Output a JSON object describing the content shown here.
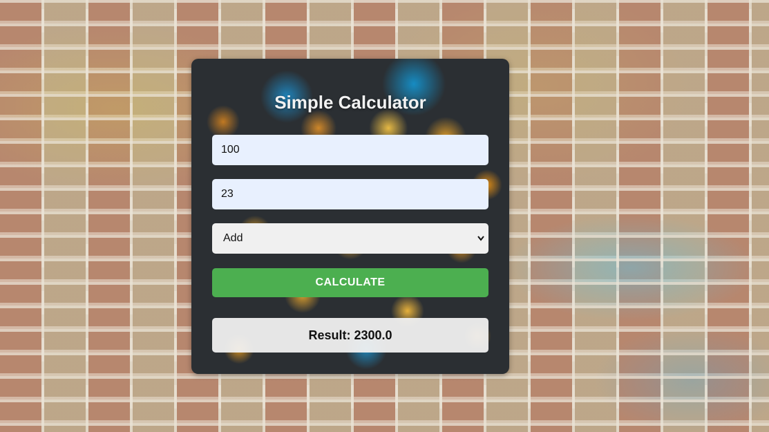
{
  "app": {
    "title": "Simple Calculator"
  },
  "form": {
    "first_number": "100",
    "second_number": "23",
    "operation": {
      "selected": "Add"
    },
    "calculate_label": "CALCULATE"
  },
  "result": {
    "text": "Result: 2300.0"
  },
  "colors": {
    "button": "#4caf50",
    "input_bg": "#e8f0fe",
    "card_bg": "#2b2f33"
  },
  "icons": {
    "select_arrow": "chevron-down-icon"
  }
}
